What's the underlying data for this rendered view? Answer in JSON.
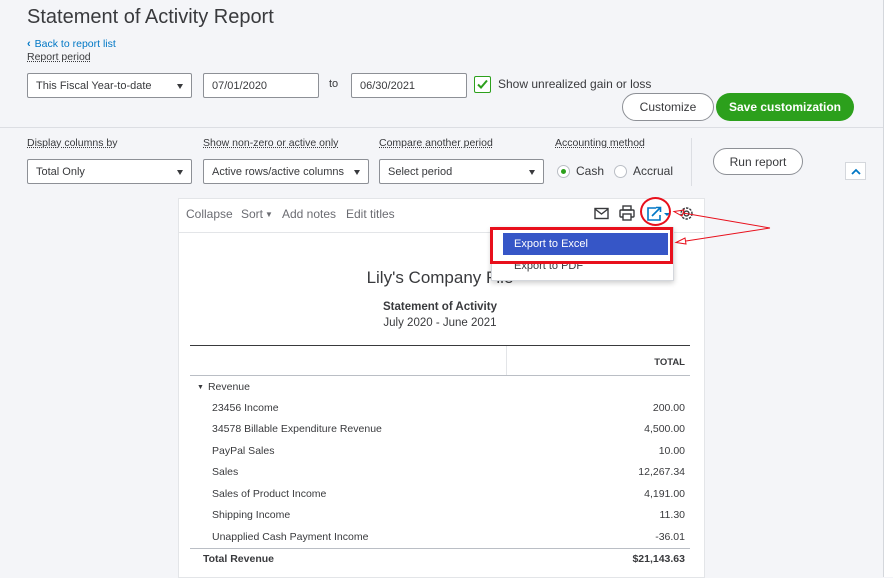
{
  "page": {
    "title": "Statement of Activity Report",
    "back_link": "Back to report list"
  },
  "period": {
    "label": "Report period",
    "preset": "This Fiscal Year-to-date",
    "start": "07/01/2020",
    "to": "to",
    "end": "06/30/2021",
    "unrealized_label": "Show unrealized gain or loss"
  },
  "actions": {
    "customize": "Customize",
    "save": "Save customization",
    "run": "Run report"
  },
  "filters": {
    "display_columns_label": "Display columns by",
    "display_columns_value": "Total Only",
    "nonzero_label": "Show non-zero or active only",
    "nonzero_value": "Active rows/active columns",
    "compare_label": "Compare another period",
    "compare_placeholder": "Select period",
    "accounting_label": "Accounting method",
    "cash": "Cash",
    "accrual": "Accrual"
  },
  "toolbar": {
    "collapse": "Collapse",
    "sort": "Sort",
    "add_notes": "Add notes",
    "edit_titles": "Edit titles"
  },
  "export_menu": {
    "excel": "Export to Excel",
    "pdf": "Export to PDF"
  },
  "report": {
    "company": "Lily's Company File",
    "name": "Statement of Activity",
    "range": "July 2020 - June 2021",
    "total_header": "TOTAL",
    "section": "Revenue",
    "rows": [
      {
        "name": "23456 Income",
        "value": "200.00"
      },
      {
        "name": "34578 Billable Expenditure Revenue",
        "value": "4,500.00"
      },
      {
        "name": "PayPal Sales",
        "value": "10.00"
      },
      {
        "name": "Sales",
        "value": "12,267.34"
      },
      {
        "name": "Sales of Product Income",
        "value": "4,191.00"
      },
      {
        "name": "Shipping Income",
        "value": "11.30"
      },
      {
        "name": "Unapplied Cash Payment Income",
        "value": "-36.01"
      }
    ],
    "total_label": "Total Revenue",
    "total_value": "$21,143.63"
  },
  "colors": {
    "accent": "#2ca01c",
    "link": "#0077c5",
    "annotation": "#e8101c",
    "menu_highlight": "#3656c7"
  }
}
